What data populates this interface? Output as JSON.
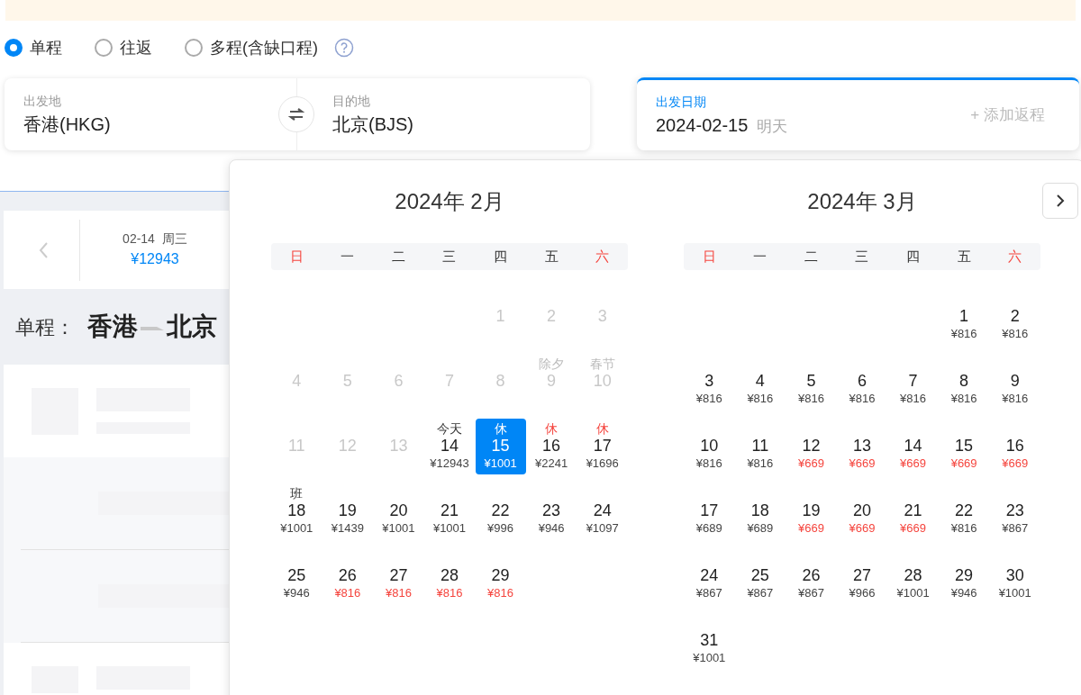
{
  "trip_types": [
    {
      "label": "单程",
      "selected": true
    },
    {
      "label": "往返",
      "selected": false
    },
    {
      "label": "多程(含缺口程)",
      "selected": false
    }
  ],
  "search": {
    "from": {
      "label": "出发地",
      "value": "香港(HKG)"
    },
    "to": {
      "label": "目的地",
      "value": "北京(BJS)"
    },
    "date": {
      "label": "出发日期",
      "value": "2024-02-15",
      "note": "明天"
    },
    "add_return": "+ 添加返程"
  },
  "date_strip": {
    "date": "02-14",
    "weekday": "周三",
    "price": "¥12943"
  },
  "route": {
    "label": "单程：",
    "from": "香港",
    "to": "北京"
  },
  "calendar": {
    "months": [
      {
        "title": "2024年 2月",
        "weekdays": [
          {
            "label": "日",
            "weekend": true
          },
          {
            "label": "一",
            "weekend": false
          },
          {
            "label": "二",
            "weekend": false
          },
          {
            "label": "三",
            "weekend": false
          },
          {
            "label": "四",
            "weekend": false
          },
          {
            "label": "五",
            "weekend": false
          },
          {
            "label": "六",
            "weekend": true
          }
        ],
        "weeks": [
          [
            {
              "kind": "empty"
            },
            {
              "kind": "empty"
            },
            {
              "kind": "empty"
            },
            {
              "kind": "empty"
            },
            {
              "kind": "day",
              "day": "1",
              "disabled": true,
              "selected": false
            },
            {
              "kind": "day",
              "day": "2",
              "disabled": true,
              "selected": false
            },
            {
              "kind": "day",
              "day": "3",
              "disabled": true,
              "selected": false
            }
          ],
          [
            {
              "kind": "day",
              "day": "4",
              "disabled": true,
              "selected": false
            },
            {
              "kind": "day",
              "day": "5",
              "disabled": true,
              "selected": false
            },
            {
              "kind": "day",
              "day": "6",
              "disabled": true,
              "selected": false
            },
            {
              "kind": "day",
              "day": "7",
              "disabled": true,
              "selected": false
            },
            {
              "kind": "day",
              "day": "8",
              "disabled": true,
              "selected": false
            },
            {
              "kind": "day",
              "day": "9",
              "note": "除夕",
              "rest_day": false,
              "disabled": true,
              "selected": false
            },
            {
              "kind": "day",
              "day": "10",
              "note": "春节",
              "rest_day": false,
              "disabled": true,
              "selected": false
            }
          ],
          [
            {
              "kind": "day",
              "day": "11",
              "disabled": true,
              "selected": false
            },
            {
              "kind": "day",
              "day": "12",
              "disabled": true,
              "selected": false
            },
            {
              "kind": "day",
              "day": "13",
              "disabled": true,
              "selected": false
            },
            {
              "kind": "day",
              "day": "14",
              "note": "今天",
              "rest_day": false,
              "price": "¥12943",
              "disabled": false,
              "selected": false,
              "cheap": false
            },
            {
              "kind": "day",
              "day": "15",
              "note": "休",
              "price": "¥1001",
              "disabled": false,
              "selected": true
            },
            {
              "kind": "day",
              "day": "16",
              "note": "休",
              "rest_day": true,
              "price": "¥2241",
              "disabled": false,
              "selected": false,
              "cheap": false
            },
            {
              "kind": "day",
              "day": "17",
              "note": "休",
              "rest_day": true,
              "price": "¥1696",
              "disabled": false,
              "selected": false,
              "cheap": false
            }
          ],
          [
            {
              "kind": "day",
              "day": "18",
              "note": "班",
              "rest_day": false,
              "price": "¥1001",
              "disabled": false,
              "selected": false,
              "cheap": false
            },
            {
              "kind": "day",
              "day": "19",
              "price": "¥1439",
              "disabled": false,
              "selected": false,
              "cheap": false
            },
            {
              "kind": "day",
              "day": "20",
              "price": "¥1001",
              "disabled": false,
              "selected": false,
              "cheap": false
            },
            {
              "kind": "day",
              "day": "21",
              "price": "¥1001",
              "disabled": false,
              "selected": false,
              "cheap": false
            },
            {
              "kind": "day",
              "day": "22",
              "price": "¥996",
              "disabled": false,
              "selected": false,
              "cheap": false
            },
            {
              "kind": "day",
              "day": "23",
              "price": "¥946",
              "disabled": false,
              "selected": false,
              "cheap": false
            },
            {
              "kind": "day",
              "day": "24",
              "price": "¥1097",
              "disabled": false,
              "selected": false,
              "cheap": false
            }
          ],
          [
            {
              "kind": "day",
              "day": "25",
              "price": "¥946",
              "disabled": false,
              "selected": false,
              "cheap": false
            },
            {
              "kind": "day",
              "day": "26",
              "price": "¥816",
              "disabled": false,
              "selected": false,
              "cheap": true
            },
            {
              "kind": "day",
              "day": "27",
              "price": "¥816",
              "disabled": false,
              "selected": false,
              "cheap": true
            },
            {
              "kind": "day",
              "day": "28",
              "price": "¥816",
              "disabled": false,
              "selected": false,
              "cheap": true
            },
            {
              "kind": "day",
              "day": "29",
              "price": "¥816",
              "disabled": false,
              "selected": false,
              "cheap": true
            }
          ]
        ]
      },
      {
        "title": "2024年 3月",
        "weekdays": [
          {
            "label": "日",
            "weekend": true
          },
          {
            "label": "一",
            "weekend": false
          },
          {
            "label": "二",
            "weekend": false
          },
          {
            "label": "三",
            "weekend": false
          },
          {
            "label": "四",
            "weekend": false
          },
          {
            "label": "五",
            "weekend": false
          },
          {
            "label": "六",
            "weekend": true
          }
        ],
        "weeks": [
          [
            {
              "kind": "empty"
            },
            {
              "kind": "empty"
            },
            {
              "kind": "empty"
            },
            {
              "kind": "empty"
            },
            {
              "kind": "empty"
            },
            {
              "kind": "day",
              "day": "1",
              "price": "¥816",
              "disabled": false,
              "selected": false,
              "cheap": false
            },
            {
              "kind": "day",
              "day": "2",
              "price": "¥816",
              "disabled": false,
              "selected": false,
              "cheap": false
            }
          ],
          [
            {
              "kind": "day",
              "day": "3",
              "price": "¥816",
              "disabled": false,
              "selected": false,
              "cheap": false
            },
            {
              "kind": "day",
              "day": "4",
              "price": "¥816",
              "disabled": false,
              "selected": false,
              "cheap": false
            },
            {
              "kind": "day",
              "day": "5",
              "price": "¥816",
              "disabled": false,
              "selected": false,
              "cheap": false
            },
            {
              "kind": "day",
              "day": "6",
              "price": "¥816",
              "disabled": false,
              "selected": false,
              "cheap": false
            },
            {
              "kind": "day",
              "day": "7",
              "price": "¥816",
              "disabled": false,
              "selected": false,
              "cheap": false
            },
            {
              "kind": "day",
              "day": "8",
              "price": "¥816",
              "disabled": false,
              "selected": false,
              "cheap": false
            },
            {
              "kind": "day",
              "day": "9",
              "price": "¥816",
              "disabled": false,
              "selected": false,
              "cheap": false
            }
          ],
          [
            {
              "kind": "day",
              "day": "10",
              "price": "¥816",
              "disabled": false,
              "selected": false,
              "cheap": false
            },
            {
              "kind": "day",
              "day": "11",
              "price": "¥816",
              "disabled": false,
              "selected": false,
              "cheap": false
            },
            {
              "kind": "day",
              "day": "12",
              "price": "¥669",
              "disabled": false,
              "selected": false,
              "cheap": true
            },
            {
              "kind": "day",
              "day": "13",
              "price": "¥669",
              "disabled": false,
              "selected": false,
              "cheap": true
            },
            {
              "kind": "day",
              "day": "14",
              "price": "¥669",
              "disabled": false,
              "selected": false,
              "cheap": true
            },
            {
              "kind": "day",
              "day": "15",
              "price": "¥669",
              "disabled": false,
              "selected": false,
              "cheap": true
            },
            {
              "kind": "day",
              "day": "16",
              "price": "¥669",
              "disabled": false,
              "selected": false,
              "cheap": true
            }
          ],
          [
            {
              "kind": "day",
              "day": "17",
              "price": "¥689",
              "disabled": false,
              "selected": false,
              "cheap": false
            },
            {
              "kind": "day",
              "day": "18",
              "price": "¥689",
              "disabled": false,
              "selected": false,
              "cheap": false
            },
            {
              "kind": "day",
              "day": "19",
              "price": "¥669",
              "disabled": false,
              "selected": false,
              "cheap": true
            },
            {
              "kind": "day",
              "day": "20",
              "price": "¥669",
              "disabled": false,
              "selected": false,
              "cheap": true
            },
            {
              "kind": "day",
              "day": "21",
              "price": "¥669",
              "disabled": false,
              "selected": false,
              "cheap": true
            },
            {
              "kind": "day",
              "day": "22",
              "price": "¥816",
              "disabled": false,
              "selected": false,
              "cheap": false
            },
            {
              "kind": "day",
              "day": "23",
              "price": "¥867",
              "disabled": false,
              "selected": false,
              "cheap": false
            }
          ],
          [
            {
              "kind": "day",
              "day": "24",
              "price": "¥867",
              "disabled": false,
              "selected": false,
              "cheap": false
            },
            {
              "kind": "day",
              "day": "25",
              "price": "¥867",
              "disabled": false,
              "selected": false,
              "cheap": false
            },
            {
              "kind": "day",
              "day": "26",
              "price": "¥867",
              "disabled": false,
              "selected": false,
              "cheap": false
            },
            {
              "kind": "day",
              "day": "27",
              "price": "¥966",
              "disabled": false,
              "selected": false,
              "cheap": false
            },
            {
              "kind": "day",
              "day": "28",
              "price": "¥1001",
              "disabled": false,
              "selected": false,
              "cheap": false
            },
            {
              "kind": "day",
              "day": "29",
              "price": "¥946",
              "disabled": false,
              "selected": false,
              "cheap": false
            },
            {
              "kind": "day",
              "day": "30",
              "price": "¥1001",
              "disabled": false,
              "selected": false,
              "cheap": false
            }
          ],
          [
            {
              "kind": "day",
              "day": "31",
              "price": "¥1001",
              "disabled": false,
              "selected": false,
              "cheap": false
            }
          ]
        ]
      }
    ]
  }
}
